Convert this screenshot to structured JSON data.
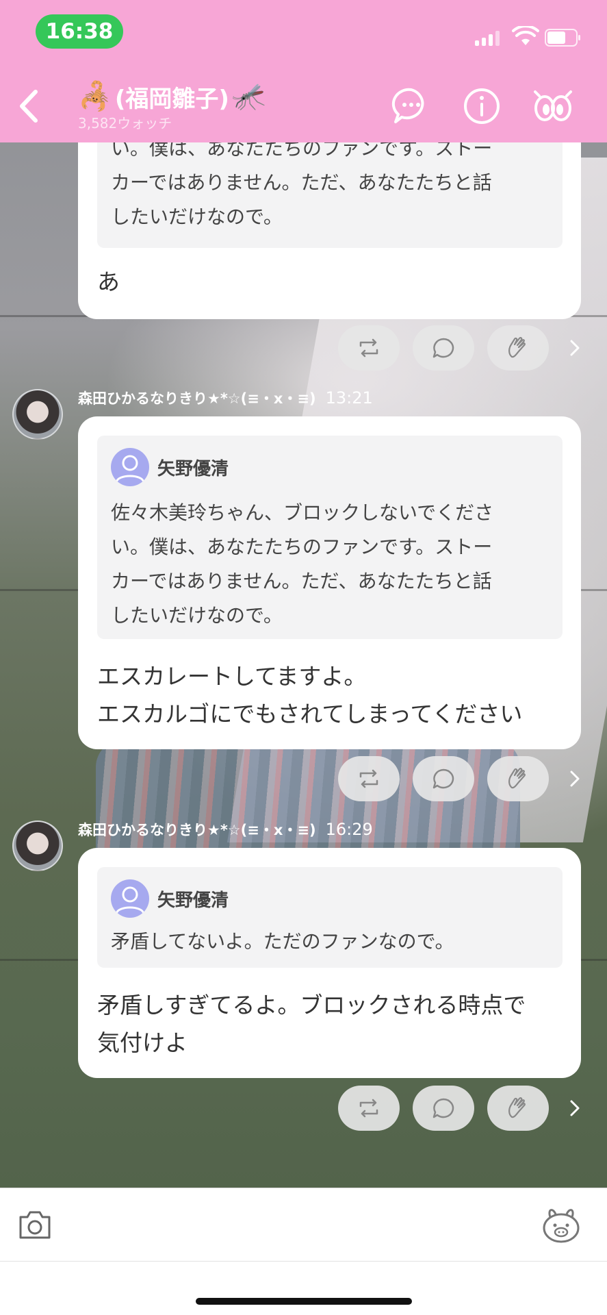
{
  "status_bar": {
    "time": "16:38"
  },
  "header": {
    "title": "(福岡雛子)",
    "left_emoji": "🦂",
    "right_emoji": "🦟",
    "watch_count": "3,582ウォッチ",
    "icons": [
      "back-chevron-icon",
      "chat-bubble-icon",
      "info-icon",
      "watch-eyes-icon"
    ]
  },
  "messages": [
    {
      "quote_body": "い。僕は、あなたたちのファンです。ストーカーではありません。ただ、あなたたちと話したいだけなので。",
      "quote_lines": [
        "い。僕は、あなたたちのファンです。ストー",
        "カーではありません。ただ、あなたたちと話",
        "したいだけなので。"
      ],
      "text_lines": [
        "あ"
      ]
    },
    {
      "sender": "森田ひかるなりきり★*☆(≡・x・≡)",
      "time": "13:21",
      "quote_name": "矢野優清",
      "quote_lines": [
        "佐々木美玲ちゃん、ブロックしないでくださ",
        "い。僕は、あなたたちのファンです。ストー",
        "カーではありません。ただ、あなたたちと話",
        "したいだけなので。"
      ],
      "text_lines": [
        "エスカレートしてますよ。",
        "エスカルゴにでもされてしまってください"
      ]
    },
    {
      "sender": "森田ひかるなりきり★*☆(≡・x・≡)",
      "time": "16:29",
      "quote_name": "矢野優清",
      "quote_lines": [
        "矛盾してないよ。ただのファンなので。"
      ],
      "text_lines": [
        "矛盾しすぎてるよ。ブロックされる時点で",
        "気付けよ"
      ]
    }
  ],
  "reaction_icons": [
    "repost-icon",
    "comment-icon",
    "clap-icon"
  ],
  "bottom_bar": {
    "icons": [
      "camera-icon",
      "stamp-icon"
    ]
  },
  "colors": {
    "header_bg": "#f7a6d6",
    "time_pill": "#35c759",
    "quote_avatar": "#a6a9ef"
  }
}
